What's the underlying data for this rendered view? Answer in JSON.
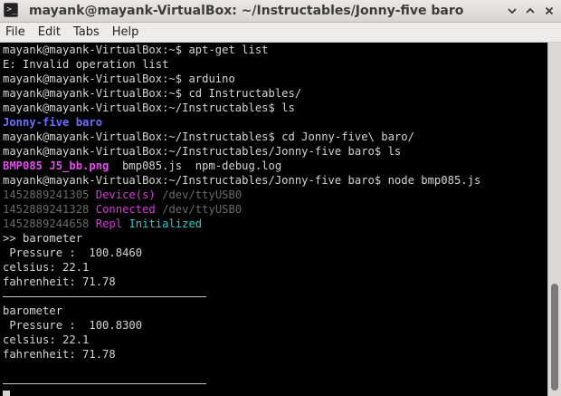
{
  "window": {
    "title": "mayank@mayank-VirtualBox: ~/Instructables/Jonny-five baro",
    "icon": "terminal-icon",
    "controls": {
      "minimize_icon": "minimize-icon",
      "maximize_icon": "maximize-icon",
      "close_icon": "close-icon"
    }
  },
  "menubar": {
    "items": [
      "File",
      "Edit",
      "Tabs",
      "Help"
    ]
  },
  "terminal": {
    "lines": [
      {
        "segments": [
          {
            "text": "mayank@mayank-VirtualBox:~$ apt-get list"
          }
        ]
      },
      {
        "segments": [
          {
            "text": "E: Invalid operation list"
          }
        ]
      },
      {
        "segments": [
          {
            "text": "mayank@mayank-VirtualBox:~$ arduino"
          }
        ]
      },
      {
        "segments": [
          {
            "text": "mayank@mayank-VirtualBox:~$ cd Instructables/"
          }
        ]
      },
      {
        "segments": [
          {
            "text": "mayank@mayank-VirtualBox:~/Instructables$ ls"
          }
        ]
      },
      {
        "segments": [
          {
            "text": "Jonny-five baro",
            "style": "dir"
          }
        ]
      },
      {
        "segments": [
          {
            "text": "mayank@mayank-VirtualBox:~/Instructables$ cd Jonny-five\\ baro/"
          }
        ]
      },
      {
        "segments": [
          {
            "text": "mayank@mayank-VirtualBox:~/Instructables/Jonny-five baro$ ls"
          }
        ]
      },
      {
        "segments": [
          {
            "text": "BMP085 J5_bb.png",
            "style": "png"
          },
          {
            "text": "  bmp085.js  npm-debug.log"
          }
        ]
      },
      {
        "segments": [
          {
            "text": "mayank@mayank-VirtualBox:~/Instructables/Jonny-five baro$ node bmp085.js"
          }
        ]
      },
      {
        "segments": [
          {
            "text": "1452889241305",
            "style": "ts"
          },
          {
            "text": " "
          },
          {
            "text": "Device(s)",
            "style": "magenta"
          },
          {
            "text": " /dev/ttyUSB0",
            "style": "ts"
          }
        ]
      },
      {
        "segments": [
          {
            "text": "1452889241328",
            "style": "ts"
          },
          {
            "text": " "
          },
          {
            "text": "Connected",
            "style": "magenta"
          },
          {
            "text": " /dev/ttyUSB0",
            "style": "ts"
          }
        ]
      },
      {
        "segments": [
          {
            "text": "1452889244658",
            "style": "ts"
          },
          {
            "text": " "
          },
          {
            "text": "Repl",
            "style": "magenta"
          },
          {
            "text": " "
          },
          {
            "text": "Initialized",
            "style": "cyan"
          }
        ]
      },
      {
        "segments": [
          {
            "text": ">> barometer"
          }
        ]
      },
      {
        "segments": [
          {
            "text": " Pressure :  100.8460"
          }
        ]
      },
      {
        "segments": [
          {
            "text": "celsius: 22.1"
          }
        ]
      },
      {
        "segments": [
          {
            "text": "fahrenheit: 71.78"
          }
        ]
      },
      {
        "rule": true,
        "segments": []
      },
      {
        "segments": [
          {
            "text": "barometer"
          }
        ]
      },
      {
        "segments": [
          {
            "text": " Pressure :  100.8300"
          }
        ]
      },
      {
        "segments": [
          {
            "text": "celsius: 22.1"
          }
        ]
      },
      {
        "segments": [
          {
            "text": "fahrenheit: 71.78"
          }
        ]
      },
      {
        "segments": []
      },
      {
        "rule": true,
        "segments": []
      },
      {
        "cursor": true,
        "segments": []
      }
    ]
  },
  "colors": {
    "background": "#000000",
    "foreground": "#d3d7cf",
    "directory": "#6d6dff",
    "image_file": "#e24fe8",
    "timestamp": "#6a6a6a",
    "repl_label": "#d23cd2",
    "initialized": "#33c9c9"
  }
}
